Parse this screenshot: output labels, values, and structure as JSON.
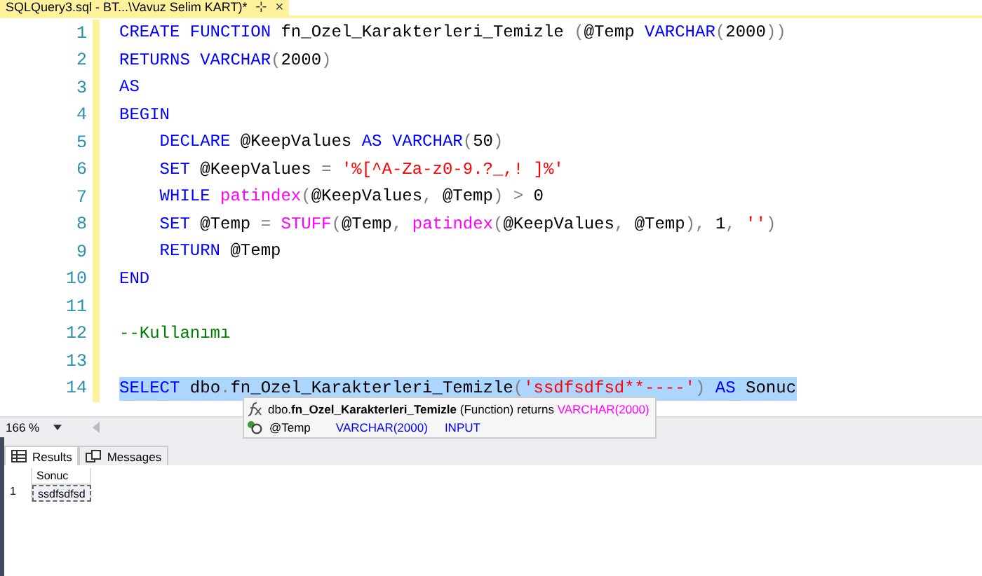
{
  "document_tab": {
    "title": "SQLQuery3.sql - BT...\\Vavuz Selim KART)*",
    "pin": "⊹",
    "close": "×"
  },
  "editor": {
    "lines": [
      {
        "number": "1",
        "selected": false,
        "tokens": [
          {
            "kind": "keyword",
            "text": "CREATE FUNCTION"
          },
          {
            "kind": "plain",
            "text": " fn_Ozel_Karakterleri_Temizle "
          },
          {
            "kind": "operator",
            "text": "("
          },
          {
            "kind": "plain",
            "text": "@Temp "
          },
          {
            "kind": "keyword",
            "text": "VARCHAR"
          },
          {
            "kind": "operator",
            "text": "("
          },
          {
            "kind": "plain",
            "text": "2000"
          },
          {
            "kind": "operator",
            "text": "))"
          }
        ]
      },
      {
        "number": "2",
        "selected": false,
        "tokens": [
          {
            "kind": "keyword",
            "text": "RETURNS VARCHAR"
          },
          {
            "kind": "operator",
            "text": "("
          },
          {
            "kind": "plain",
            "text": "2000"
          },
          {
            "kind": "operator",
            "text": ")"
          }
        ]
      },
      {
        "number": "3",
        "selected": false,
        "tokens": [
          {
            "kind": "keyword",
            "text": "AS"
          }
        ]
      },
      {
        "number": "4",
        "selected": false,
        "tokens": [
          {
            "kind": "keyword",
            "text": "BEGIN"
          }
        ]
      },
      {
        "number": "5",
        "selected": false,
        "tokens": [
          {
            "kind": "keyword",
            "text": "    DECLARE"
          },
          {
            "kind": "plain",
            "text": " @KeepValues "
          },
          {
            "kind": "keyword",
            "text": "AS VARCHAR"
          },
          {
            "kind": "operator",
            "text": "("
          },
          {
            "kind": "plain",
            "text": "50"
          },
          {
            "kind": "operator",
            "text": ")"
          }
        ]
      },
      {
        "number": "6",
        "selected": false,
        "tokens": [
          {
            "kind": "keyword",
            "text": "    SET"
          },
          {
            "kind": "plain",
            "text": " @KeepValues "
          },
          {
            "kind": "operator",
            "text": "="
          },
          {
            "kind": "string",
            "text": " '%[^A-Za-z0-9.?_,! ]%'"
          }
        ]
      },
      {
        "number": "7",
        "selected": false,
        "tokens": [
          {
            "kind": "keyword",
            "text": "    WHILE"
          },
          {
            "kind": "function",
            "text": " patindex"
          },
          {
            "kind": "operator",
            "text": "("
          },
          {
            "kind": "plain",
            "text": "@KeepValues"
          },
          {
            "kind": "operator",
            "text": ","
          },
          {
            "kind": "plain",
            "text": " @Temp"
          },
          {
            "kind": "operator",
            "text": ")"
          },
          {
            "kind": "operator",
            "text": " >"
          },
          {
            "kind": "plain",
            "text": " 0"
          }
        ]
      },
      {
        "number": "8",
        "selected": false,
        "tokens": [
          {
            "kind": "keyword",
            "text": "    SET"
          },
          {
            "kind": "plain",
            "text": " @Temp "
          },
          {
            "kind": "operator",
            "text": "="
          },
          {
            "kind": "function",
            "text": " STUFF"
          },
          {
            "kind": "operator",
            "text": "("
          },
          {
            "kind": "plain",
            "text": "@Temp"
          },
          {
            "kind": "operator",
            "text": ","
          },
          {
            "kind": "function",
            "text": " patindex"
          },
          {
            "kind": "operator",
            "text": "("
          },
          {
            "kind": "plain",
            "text": "@KeepValues"
          },
          {
            "kind": "operator",
            "text": ","
          },
          {
            "kind": "plain",
            "text": " @Temp"
          },
          {
            "kind": "operator",
            "text": "),"
          },
          {
            "kind": "plain",
            "text": " 1"
          },
          {
            "kind": "operator",
            "text": ","
          },
          {
            "kind": "string",
            "text": " ''"
          },
          {
            "kind": "operator",
            "text": ")"
          }
        ]
      },
      {
        "number": "9",
        "selected": false,
        "tokens": [
          {
            "kind": "keyword",
            "text": "    RETURN"
          },
          {
            "kind": "plain",
            "text": " @Temp"
          }
        ]
      },
      {
        "number": "10",
        "selected": false,
        "tokens": [
          {
            "kind": "keyword",
            "text": "END"
          }
        ]
      },
      {
        "number": "11",
        "selected": false
      },
      {
        "number": "12",
        "selected": false,
        "tokens": [
          {
            "kind": "comment",
            "text": "--Kullanımı"
          }
        ]
      },
      {
        "number": "13",
        "selected": false
      },
      {
        "number": "14",
        "selected": true,
        "tokens": [
          {
            "kind": "keyword",
            "text": "SELECT"
          },
          {
            "kind": "plain",
            "text": " dbo"
          },
          {
            "kind": "operator",
            "text": "."
          },
          {
            "kind": "plain",
            "text": "fn_Ozel_Karakterleri_Temizle"
          },
          {
            "kind": "operator",
            "text": "("
          },
          {
            "kind": "string",
            "text": "'ssdfsdfsd**----'"
          },
          {
            "kind": "operator",
            "text": ")"
          },
          {
            "kind": "keyword",
            "text": " AS"
          },
          {
            "kind": "plain",
            "text": " Sonuc"
          }
        ]
      }
    ]
  },
  "tooltip": {
    "signature": [
      {
        "kind": "plain",
        "text": "dbo."
      },
      {
        "kind": "bold",
        "text": "fn_Ozel_Karakterleri_Temizle"
      },
      {
        "kind": "plain",
        "text": " (Function) returns "
      },
      {
        "kind": "type",
        "text": "VARCHAR(2000)"
      }
    ],
    "parameter": {
      "name": "@Temp",
      "type": "VARCHAR(2000)",
      "direction": "INPUT"
    }
  },
  "zoom": {
    "value": "166 %"
  },
  "result_tabs": [
    {
      "label": "Results",
      "selected": true
    },
    {
      "label": "Messages",
      "selected": false
    }
  ],
  "results": {
    "columns": [
      "Sonuc"
    ],
    "rows": [
      {
        "number": "1",
        "cells": [
          "ssdfsdfsd"
        ]
      }
    ]
  }
}
